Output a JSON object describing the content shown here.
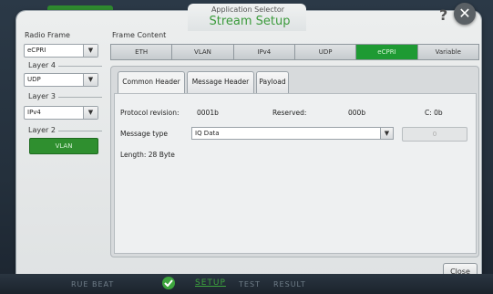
{
  "window": {
    "app_title": "Application Selector",
    "title": "Stream Setup",
    "help_label": "?",
    "close_label": "✕"
  },
  "left_panel": {
    "radio_frame_label": "Radio Frame",
    "radio_frame_value": "eCPRI",
    "layer4_label": "Layer 4",
    "layer4_value": "UDP",
    "layer3_label": "Layer 3",
    "layer3_value": "IPv4",
    "layer2_label": "Layer 2",
    "layer2_value": "VLAN"
  },
  "frame_content": {
    "label": "Frame Content",
    "tabs": [
      "ETH",
      "VLAN",
      "IPv4",
      "UDP",
      "eCPRI",
      "Variable"
    ],
    "active_tab": "eCPRI"
  },
  "sub_tabs": [
    "Common Header",
    "Message Header",
    "Payload"
  ],
  "common_header": {
    "protocol_revision_label": "Protocol revision:",
    "protocol_revision_value": "0001b",
    "reserved_label": "Reserved:",
    "reserved_value": "000b",
    "c_label": "C: 0b",
    "message_type_label": "Message type",
    "message_type_value": "IQ Data",
    "disabled_value": "0",
    "length_label": "Length: 28 Byte"
  },
  "footer": {
    "close_label": "Close"
  },
  "bottom_bar": {
    "items": [
      "RUE BEAT",
      "SETUP",
      "TEST",
      "RESULT"
    ]
  },
  "colors": {
    "accent_green": "#1e9a33",
    "title_green": "#3b9a3b"
  }
}
